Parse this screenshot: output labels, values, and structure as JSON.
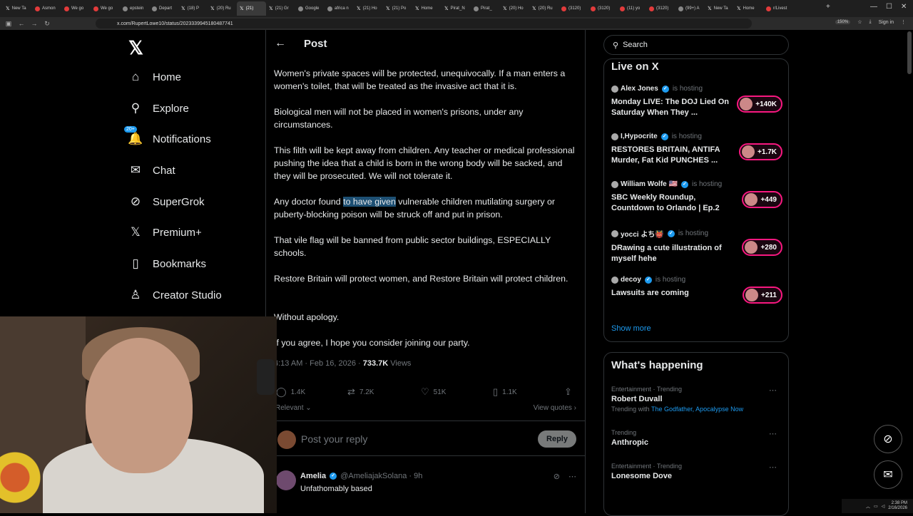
{
  "browser": {
    "tabs": [
      {
        "label": "New Ta",
        "fav": "x"
      },
      {
        "label": "Asmon",
        "fav": "red"
      },
      {
        "label": "We go",
        "fav": "red"
      },
      {
        "label": "We go",
        "fav": "red"
      },
      {
        "label": "epstein",
        "fav": "o"
      },
      {
        "label": "Depart",
        "fav": "o"
      },
      {
        "label": "(18) P",
        "fav": "x"
      },
      {
        "label": "(20) Ru",
        "fav": "x"
      },
      {
        "label": "(21)",
        "fav": "x",
        "active": true
      },
      {
        "label": "(21) Gr",
        "fav": "x"
      },
      {
        "label": "Google",
        "fav": "o"
      },
      {
        "label": "africa n",
        "fav": "o"
      },
      {
        "label": "(21) Ho",
        "fav": "x"
      },
      {
        "label": "(21) Po",
        "fav": "x"
      },
      {
        "label": "Home",
        "fav": "x"
      },
      {
        "label": "Pirat_N",
        "fav": "x"
      },
      {
        "label": "Pirat_",
        "fav": "o"
      },
      {
        "label": "(20) Ho",
        "fav": "x"
      },
      {
        "label": "(20) Ru",
        "fav": "x"
      },
      {
        "label": "(3120)",
        "fav": "red"
      },
      {
        "label": "(3120)",
        "fav": "red"
      },
      {
        "label": "(11) yo",
        "fav": "red"
      },
      {
        "label": "(3120)",
        "fav": "red"
      },
      {
        "label": "(99+) A",
        "fav": "o"
      },
      {
        "label": "New Ta",
        "fav": "x"
      },
      {
        "label": "Home",
        "fav": "x"
      },
      {
        "label": "r/Livest",
        "fav": "red"
      }
    ],
    "url": "x.com/RupertLowe10/status/2023339945180487741",
    "zoom": "150%",
    "signin": "Sign in",
    "new_tab": "+",
    "minimize": "—",
    "maximize": "☐",
    "close": "✕"
  },
  "nav": {
    "items": [
      {
        "label": "Home",
        "icon": "home-icon",
        "glyph": "⌂"
      },
      {
        "label": "Explore",
        "icon": "search-icon",
        "glyph": "⚲"
      },
      {
        "label": "Notifications",
        "icon": "bell-icon",
        "glyph": "🔔",
        "badge": "20+"
      },
      {
        "label": "Chat",
        "icon": "mail-icon",
        "glyph": "✉"
      },
      {
        "label": "SuperGrok",
        "icon": "grok-icon",
        "glyph": "⊘"
      },
      {
        "label": "Premium+",
        "icon": "x-icon",
        "glyph": "𝕏"
      },
      {
        "label": "Bookmarks",
        "icon": "bookmark-icon",
        "glyph": "▯"
      },
      {
        "label": "Creator Studio",
        "icon": "person-icon",
        "glyph": "♙"
      }
    ]
  },
  "post": {
    "header": "Post",
    "paragraphs": [
      "Women's private spaces will be protected, unequivocally. If a man enters a women's toilet, that will be treated as the invasive act that it is.",
      "Biological men will not be placed in women's prisons, under any circumstances.",
      "This filth will be kept away from children. Any teacher or medical professional pushing the idea that a child is born in the wrong body will be sacked, and they will be prosecuted. We will not tolerate it.",
      {
        "before": "Any doctor found ",
        "highlight": "to have given",
        "after": " vulnerable children mutilating surgery or puberty-blocking poison will be struck off and put in prison."
      },
      "That vile flag will be banned from public sector buildings, ESPECIALLY schools.",
      "Restore Britain will protect women, and Restore Britain will protect children.",
      "Without apology.",
      "If you agree, I hope you consider joining our party."
    ],
    "time": "4:13 AM · Feb 16, 2026 · ",
    "views_count": "733.7K",
    "views_label": " Views",
    "replies": "1.4K",
    "reposts": "7.2K",
    "likes": "51K",
    "bookmarks": "1.1K",
    "sort": "Relevant",
    "view_quotes": "View quotes"
  },
  "reply_box": {
    "placeholder": "Post your reply",
    "button": "Reply"
  },
  "comment": {
    "name": "Amelia",
    "handle": "@AmeliajakSolana",
    "age": "· 9h",
    "text": "Unfathomably based"
  },
  "search": {
    "placeholder": "Search"
  },
  "live": {
    "title": "Live on X",
    "is_hosting": "is hosting",
    "entries": [
      {
        "host": "Alex Jones",
        "verified": true,
        "title": "Monday LIVE: The DOJ Lied On Saturday When They ...",
        "count": "+140K"
      },
      {
        "host": "I,Hypocrite",
        "verified": true,
        "title": "RESTORES BRITAIN, ANTIFA Murder, Fat Kid PUNCHES ...",
        "count": "+1.7K"
      },
      {
        "host": "William Wolfe 🇺🇸",
        "verified": true,
        "title": "SBC Weekly Roundup, Countdown to Orlando | Ep.2",
        "count": "+449"
      },
      {
        "host": "yocci よち👹",
        "verified": true,
        "title": "DRawing a cute illustration of myself hehe",
        "count": "+280"
      },
      {
        "host": "decoy",
        "verified": true,
        "title": "Lawsuits are coming",
        "count": "+211"
      }
    ],
    "show_more": "Show more"
  },
  "happening": {
    "title": "What's happening",
    "trends": [
      {
        "cat": "Entertainment · Trending",
        "name": "Robert Duvall",
        "sub_prefix": "Trending with ",
        "sub_links": "The Godfather, Apocalypse Now"
      },
      {
        "cat": "Trending",
        "name": "Anthropic"
      },
      {
        "cat": "Entertainment · Trending",
        "name": "Lonesome Dove"
      }
    ]
  },
  "taskbar": {
    "time": "2:38 PM",
    "date": "2/16/2026"
  }
}
